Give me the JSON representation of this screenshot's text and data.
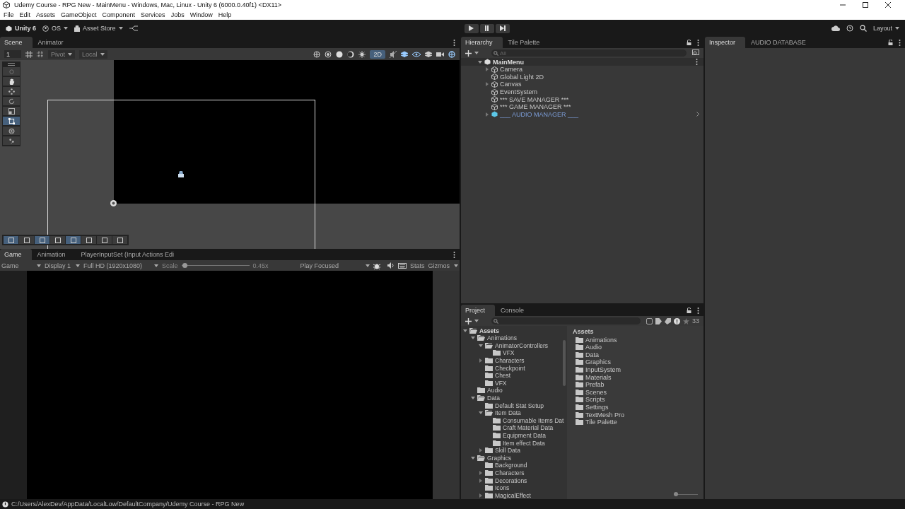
{
  "window": {
    "title": "Udemy Course - RPG New - MainMenu - Windows, Mac, Linux - Unity 6 (6000.0.40f1) <DX11>"
  },
  "menu": [
    "File",
    "Edit",
    "Assets",
    "GameObject",
    "Component",
    "Services",
    "Jobs",
    "Window",
    "Help"
  ],
  "toolbar": {
    "account": "Unity 6",
    "os": "OS",
    "store": "Asset Store",
    "layout": "Layout"
  },
  "scene": {
    "tabs": [
      {
        "label": "Scene",
        "selected": true
      },
      {
        "label": "Animator",
        "selected": false
      }
    ],
    "grid_size": "1",
    "pivot": "Pivot",
    "space": "Local",
    "mode_2d": {
      "label": "2D",
      "on": true
    },
    "tools": [
      {
        "kind": "view",
        "selected": false
      },
      {
        "kind": "hand",
        "selected": false
      },
      {
        "kind": "move",
        "selected": false
      },
      {
        "kind": "rotate",
        "selected": false
      },
      {
        "kind": "scale",
        "selected": false
      },
      {
        "kind": "rect",
        "selected": true
      },
      {
        "kind": "transform",
        "selected": false
      },
      {
        "kind": "custom",
        "selected": false
      }
    ],
    "overlay_tools": [
      {
        "selected": true
      },
      {
        "selected": false
      },
      {
        "selected": true
      },
      {
        "selected": false
      },
      {
        "selected": true
      },
      {
        "selected": false
      },
      {
        "selected": false
      },
      {
        "selected": false
      }
    ]
  },
  "game": {
    "tabs": [
      {
        "label": "Game",
        "selected": true
      },
      {
        "label": "Animation",
        "selected": false
      },
      {
        "label": "PlayerInputSet (Input Actions Edi",
        "selected": false
      }
    ],
    "view": "Game",
    "display": "Display 1",
    "resolution": "Full HD (1920x1080)",
    "scale_label": "Scale",
    "scale": {
      "level": 0.02
    },
    "scale_reading": "0.45x",
    "play_mode": "Play Focused",
    "stats": "Stats",
    "gizmos": "Gizmos"
  },
  "hierarchy": {
    "tabs": [
      {
        "label": "Hierarchy",
        "selected": true
      },
      {
        "label": "Tile Palette",
        "selected": false
      }
    ],
    "search": {
      "placeholder": "All"
    },
    "root": "MainMenu",
    "objects": [
      {
        "name": "Camera",
        "arrow": true,
        "prefab": false
      },
      {
        "name": "Global Light 2D",
        "arrow": false,
        "prefab": false
      },
      {
        "name": "Canvas",
        "arrow": true,
        "prefab": false
      },
      {
        "name": "EventSystem",
        "arrow": false,
        "prefab": false
      },
      {
        "name": "*** SAVE MANAGER ***",
        "arrow": false,
        "prefab": false
      },
      {
        "name": "*** GAME MANAGER ***",
        "arrow": false,
        "prefab": false
      },
      {
        "name": "___ AUDIO MANAGER ___",
        "arrow": true,
        "prefab": true
      }
    ]
  },
  "inspector": {
    "tabs": [
      {
        "label": "Inspector",
        "selected": true
      },
      {
        "label": "AUDIO DATABASE",
        "selected": false
      }
    ]
  },
  "project": {
    "tabs": [
      {
        "label": "Project",
        "selected": true
      },
      {
        "label": "Console",
        "selected": false
      }
    ],
    "count": "33",
    "tree": [
      {
        "name": "Assets",
        "arrow": true,
        "expanded": true,
        "children": [
          {
            "name": "Animations",
            "arrow": true,
            "expanded": true,
            "children": [
              {
                "name": "AnimatorControllers",
                "arrow": true,
                "expanded": true,
                "children": [
                  {
                    "name": "VFX",
                    "arrow": false,
                    "expanded": false
                  }
                ]
              },
              {
                "name": "Characters",
                "arrow": true,
                "expanded": false
              },
              {
                "name": "Checkpoint",
                "arrow": false,
                "expanded": false
              },
              {
                "name": "Chest",
                "arrow": false,
                "expanded": false
              },
              {
                "name": "VFX",
                "arrow": false,
                "expanded": false
              }
            ]
          },
          {
            "name": "Audio",
            "arrow": false,
            "expanded": false
          },
          {
            "name": "Data",
            "arrow": true,
            "expanded": true,
            "children": [
              {
                "name": "Default Stat Setup",
                "arrow": false,
                "expanded": false
              },
              {
                "name": "Item Data",
                "arrow": true,
                "expanded": true,
                "children": [
                  {
                    "name": "Consumable Items Dat",
                    "arrow": false,
                    "expanded": false
                  },
                  {
                    "name": "Craft Material Data",
                    "arrow": false,
                    "expanded": false
                  },
                  {
                    "name": "Equipment Data",
                    "arrow": false,
                    "expanded": false
                  },
                  {
                    "name": "Item effect Data",
                    "arrow": false,
                    "expanded": false
                  }
                ]
              },
              {
                "name": "Skill Data",
                "arrow": true,
                "expanded": false
              }
            ]
          },
          {
            "name": "Graphics",
            "arrow": true,
            "expanded": true,
            "children": [
              {
                "name": "Background",
                "arrow": false,
                "expanded": false
              },
              {
                "name": "Characters",
                "arrow": true,
                "expanded": false
              },
              {
                "name": "Decorations",
                "arrow": true,
                "expanded": false
              },
              {
                "name": "Icons",
                "arrow": false,
                "expanded": false
              },
              {
                "name": "MagicalEffect",
                "arrow": true,
                "expanded": false
              }
            ]
          }
        ]
      }
    ],
    "breadcrumb": "Assets",
    "icon_size": {
      "level": 0.0
    },
    "folders": [
      "Animations",
      "Audio",
      "Data",
      "Graphics",
      "InputSystem",
      "Materials",
      "Prefab",
      "Scenes",
      "Scripts",
      "Settings",
      "TextMesh Pro",
      "Tile Palette"
    ]
  },
  "status_bar": {
    "path": "C:/Users/AlexDev/AppData/LocalLow/DefaultCompany/Udemy Course - RPG New"
  }
}
